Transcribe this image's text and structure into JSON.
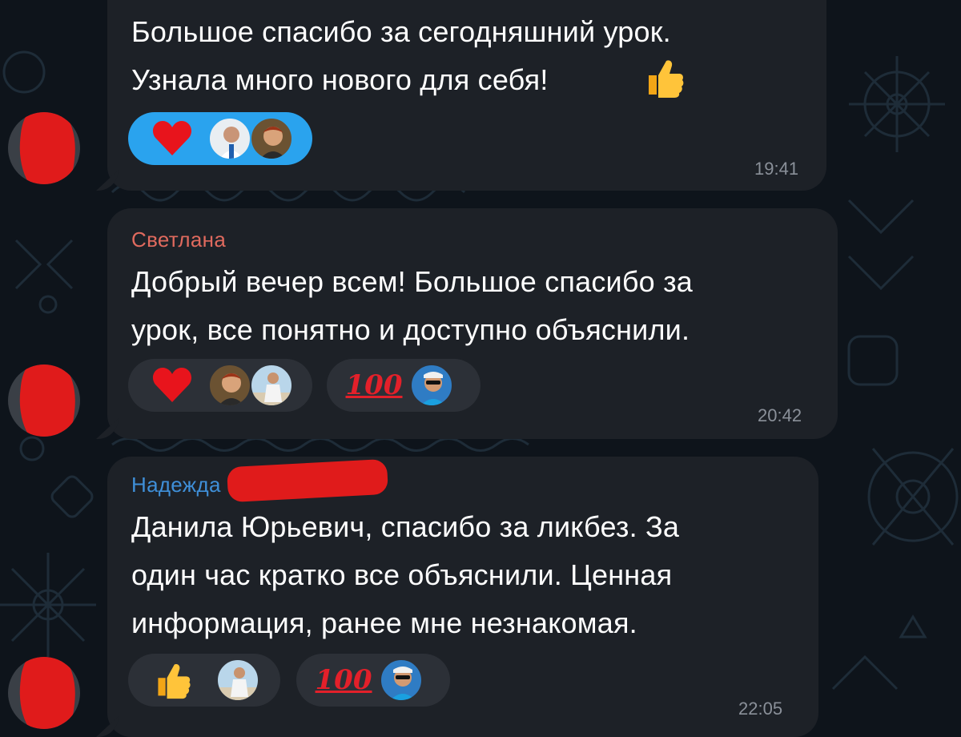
{
  "colors": {
    "background": "#0e141b",
    "bubble": "#1d2127",
    "reaction_bg": "#2c3037",
    "reaction_selected": "#2aa3ee",
    "sender_svetlana": "#e06a5e",
    "sender_nadezhda": "#3f8fd8",
    "timestamp": "#8a9099",
    "redaction": "#e01b1b"
  },
  "messages": [
    {
      "text": "Большое спасибо за сегодняшний урок.\nУзнала много нового для себя!",
      "trailing_emoji": "thumbs-up-icon",
      "time": "19:41",
      "reactions": [
        {
          "emoji": "heart-icon",
          "selected": true,
          "avatars": [
            "avatar-man-white-coat",
            "avatar-woman-glasses"
          ]
        }
      ]
    },
    {
      "sender": "Светлана",
      "text": "Добрый вечер всем! Большое спасибо за\nурок, все понятно и доступно объяснили.",
      "time": "20:42",
      "reactions": [
        {
          "emoji": "heart-icon",
          "selected": false,
          "avatars": [
            "avatar-woman-glasses",
            "avatar-woman-beach"
          ]
        },
        {
          "emoji_text": "100",
          "emoji": "hundred-points-icon",
          "selected": false,
          "avatars": [
            "avatar-man-cap"
          ]
        }
      ]
    },
    {
      "sender": "Надежда",
      "text": "Данила Юрьевич, спасибо за ликбез. За\nодин час кратко все объяснили. Ценная\nинформация, ранее мне незнакомая.",
      "time": "22:05",
      "reactions": [
        {
          "emoji": "thumbs-up-icon",
          "selected": false,
          "avatars": [
            "avatar-woman-beach"
          ]
        },
        {
          "emoji_text": "100",
          "emoji": "hundred-points-icon",
          "selected": false,
          "avatars": [
            "avatar-man-cap"
          ]
        }
      ]
    }
  ]
}
